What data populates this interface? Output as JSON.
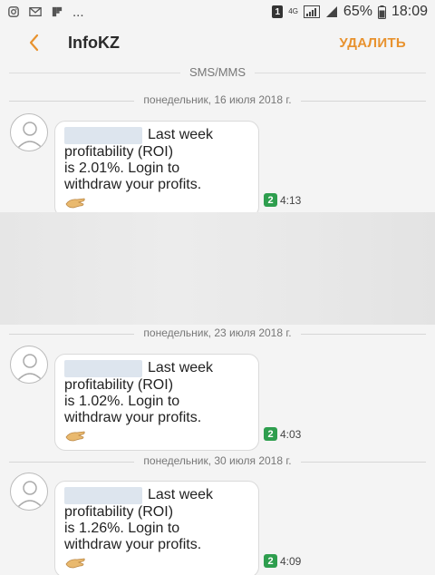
{
  "statusbar": {
    "icons_left": [
      "instagram-icon",
      "mail-icon",
      "flipboard-icon"
    ],
    "more": "...",
    "sim": "1",
    "network": "4G",
    "battery": "65%",
    "time": "18:09"
  },
  "appbar": {
    "back_icon": "chevron-left-icon",
    "title": "InfoKZ",
    "delete_label": "УДАЛИТЬ"
  },
  "thread_type": "SMS/MMS",
  "colors": {
    "accent": "#e8922e",
    "sim_badge": "#2e9e4e"
  },
  "messages": [
    {
      "date": "понедельник, 16 июля 2018 г.",
      "line1": "Last week",
      "line2": "profitability (ROI)",
      "line3": "is 2.01%. Login to",
      "line4": "withdraw your profits.",
      "sim": "2",
      "time": "4:13"
    },
    {
      "date": "понедельник, 23 июля 2018 г.",
      "line1": "Last week",
      "line2": "profitability (ROI)",
      "line3": "is 1.02%. Login to",
      "line4": "withdraw your profits.",
      "sim": "2",
      "time": "4:03"
    },
    {
      "date": "понедельник, 30 июля 2018 г.",
      "line1": "Last week",
      "line2": "profitability (ROI)",
      "line3": "is 1.26%. Login to",
      "line4": "withdraw your profits.",
      "sim": "2",
      "time": "4:09"
    }
  ]
}
